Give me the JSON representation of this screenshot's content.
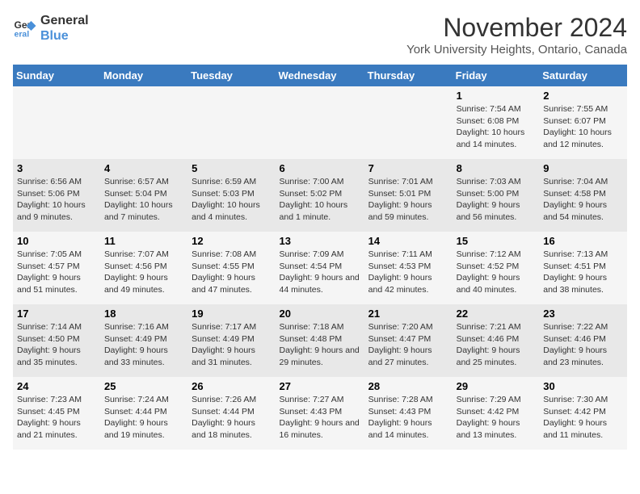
{
  "logo": {
    "line1": "General",
    "line2": "Blue"
  },
  "title": "November 2024",
  "subtitle": "York University Heights, Ontario, Canada",
  "weekdays": [
    "Sunday",
    "Monday",
    "Tuesday",
    "Wednesday",
    "Thursday",
    "Friday",
    "Saturday"
  ],
  "weeks": [
    [
      {
        "day": "",
        "info": ""
      },
      {
        "day": "",
        "info": ""
      },
      {
        "day": "",
        "info": ""
      },
      {
        "day": "",
        "info": ""
      },
      {
        "day": "",
        "info": ""
      },
      {
        "day": "1",
        "info": "Sunrise: 7:54 AM\nSunset: 6:08 PM\nDaylight: 10 hours and 14 minutes."
      },
      {
        "day": "2",
        "info": "Sunrise: 7:55 AM\nSunset: 6:07 PM\nDaylight: 10 hours and 12 minutes."
      }
    ],
    [
      {
        "day": "3",
        "info": "Sunrise: 6:56 AM\nSunset: 5:06 PM\nDaylight: 10 hours and 9 minutes."
      },
      {
        "day": "4",
        "info": "Sunrise: 6:57 AM\nSunset: 5:04 PM\nDaylight: 10 hours and 7 minutes."
      },
      {
        "day": "5",
        "info": "Sunrise: 6:59 AM\nSunset: 5:03 PM\nDaylight: 10 hours and 4 minutes."
      },
      {
        "day": "6",
        "info": "Sunrise: 7:00 AM\nSunset: 5:02 PM\nDaylight: 10 hours and 1 minute."
      },
      {
        "day": "7",
        "info": "Sunrise: 7:01 AM\nSunset: 5:01 PM\nDaylight: 9 hours and 59 minutes."
      },
      {
        "day": "8",
        "info": "Sunrise: 7:03 AM\nSunset: 5:00 PM\nDaylight: 9 hours and 56 minutes."
      },
      {
        "day": "9",
        "info": "Sunrise: 7:04 AM\nSunset: 4:58 PM\nDaylight: 9 hours and 54 minutes."
      }
    ],
    [
      {
        "day": "10",
        "info": "Sunrise: 7:05 AM\nSunset: 4:57 PM\nDaylight: 9 hours and 51 minutes."
      },
      {
        "day": "11",
        "info": "Sunrise: 7:07 AM\nSunset: 4:56 PM\nDaylight: 9 hours and 49 minutes."
      },
      {
        "day": "12",
        "info": "Sunrise: 7:08 AM\nSunset: 4:55 PM\nDaylight: 9 hours and 47 minutes."
      },
      {
        "day": "13",
        "info": "Sunrise: 7:09 AM\nSunset: 4:54 PM\nDaylight: 9 hours and 44 minutes."
      },
      {
        "day": "14",
        "info": "Sunrise: 7:11 AM\nSunset: 4:53 PM\nDaylight: 9 hours and 42 minutes."
      },
      {
        "day": "15",
        "info": "Sunrise: 7:12 AM\nSunset: 4:52 PM\nDaylight: 9 hours and 40 minutes."
      },
      {
        "day": "16",
        "info": "Sunrise: 7:13 AM\nSunset: 4:51 PM\nDaylight: 9 hours and 38 minutes."
      }
    ],
    [
      {
        "day": "17",
        "info": "Sunrise: 7:14 AM\nSunset: 4:50 PM\nDaylight: 9 hours and 35 minutes."
      },
      {
        "day": "18",
        "info": "Sunrise: 7:16 AM\nSunset: 4:49 PM\nDaylight: 9 hours and 33 minutes."
      },
      {
        "day": "19",
        "info": "Sunrise: 7:17 AM\nSunset: 4:49 PM\nDaylight: 9 hours and 31 minutes."
      },
      {
        "day": "20",
        "info": "Sunrise: 7:18 AM\nSunset: 4:48 PM\nDaylight: 9 hours and 29 minutes."
      },
      {
        "day": "21",
        "info": "Sunrise: 7:20 AM\nSunset: 4:47 PM\nDaylight: 9 hours and 27 minutes."
      },
      {
        "day": "22",
        "info": "Sunrise: 7:21 AM\nSunset: 4:46 PM\nDaylight: 9 hours and 25 minutes."
      },
      {
        "day": "23",
        "info": "Sunrise: 7:22 AM\nSunset: 4:46 PM\nDaylight: 9 hours and 23 minutes."
      }
    ],
    [
      {
        "day": "24",
        "info": "Sunrise: 7:23 AM\nSunset: 4:45 PM\nDaylight: 9 hours and 21 minutes."
      },
      {
        "day": "25",
        "info": "Sunrise: 7:24 AM\nSunset: 4:44 PM\nDaylight: 9 hours and 19 minutes."
      },
      {
        "day": "26",
        "info": "Sunrise: 7:26 AM\nSunset: 4:44 PM\nDaylight: 9 hours and 18 minutes."
      },
      {
        "day": "27",
        "info": "Sunrise: 7:27 AM\nSunset: 4:43 PM\nDaylight: 9 hours and 16 minutes."
      },
      {
        "day": "28",
        "info": "Sunrise: 7:28 AM\nSunset: 4:43 PM\nDaylight: 9 hours and 14 minutes."
      },
      {
        "day": "29",
        "info": "Sunrise: 7:29 AM\nSunset: 4:42 PM\nDaylight: 9 hours and 13 minutes."
      },
      {
        "day": "30",
        "info": "Sunrise: 7:30 AM\nSunset: 4:42 PM\nDaylight: 9 hours and 11 minutes."
      }
    ]
  ]
}
